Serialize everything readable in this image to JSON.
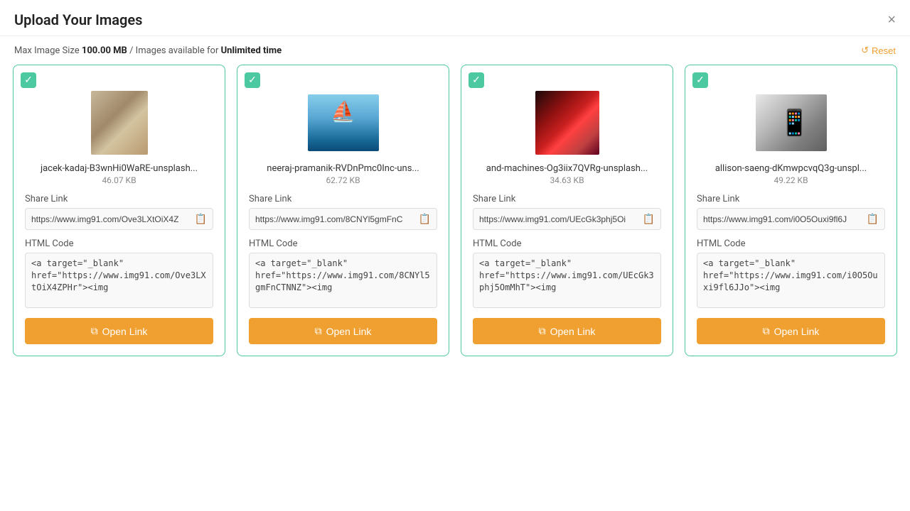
{
  "header": {
    "title": "Upload Your Images",
    "close_label": "×"
  },
  "subheader": {
    "prefix": "Max Image Size ",
    "max_size": "100.00 MB",
    "separator": " / Images available for ",
    "availability": "Unlimited time",
    "reset_label": "Reset"
  },
  "cards": [
    {
      "id": 1,
      "filename": "jacek-kadaj-B3wnHi0WaRE-unsplash...",
      "filesize": "46.07 KB",
      "share_link": "https://www.img91.com/Ove3LXtOiX4Z",
      "share_link_display": "https://www.img91.com/Ove3LXtOiX4Z",
      "html_code": "<a target=\"_blank\" href=\"https://www.img91.com/Ove3LXtOiX4ZPHr\"><img",
      "open_link_label": "Open Link",
      "img_type": "book"
    },
    {
      "id": 2,
      "filename": "neeraj-pramanik-RVDnPmc0Inc-uns...",
      "filesize": "62.72 KB",
      "share_link": "https://www.img91.com/8CNYl5gmFnC",
      "share_link_display": "https://www.img91.com/8CNYl5gmFnC",
      "html_code": "<a target=\"_blank\" href=\"https://www.img91.com/8CNYl5gmFnCTNNZ\"><img",
      "open_link_label": "Open Link",
      "img_type": "boat"
    },
    {
      "id": 3,
      "filename": "and-machines-Og3iix7QVRg-unsplash...",
      "filesize": "34.63 KB",
      "share_link": "https://www.img91.com/UEcGk3phj5Oi",
      "share_link_display": "https://www.img91.com/UEcGk3phj5Oi",
      "html_code": "<a target=\"_blank\" href=\"https://www.img91.com/UEcGk3phj5OmMhT\"><img",
      "open_link_label": "Open Link",
      "img_type": "abstract"
    },
    {
      "id": 4,
      "filename": "allison-saeng-dKmwpcvqQ3g-unspl...",
      "filesize": "49.22 KB",
      "share_link": "https://www.img91.com/i0O5Ouxi9fl6J",
      "share_link_display": "https://www.img91.com/i0O5Ouxi9fl6J",
      "html_code": "<a target=\"_blank\" href=\"https://www.img91.com/i0O5Ouxi9fl6JJo\"><img",
      "open_link_label": "Open Link",
      "img_type": "phone"
    }
  ],
  "labels": {
    "share_link": "Share Link",
    "html_code": "HTML Code",
    "checkmark": "✓"
  }
}
